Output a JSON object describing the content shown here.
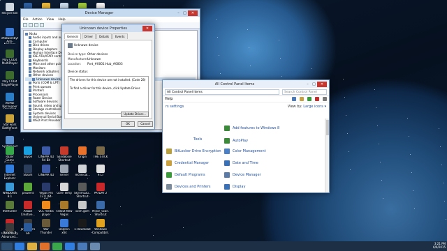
{
  "desktop": {
    "icons": [
      {
        "label": "Recycle Bin",
        "color": "#cfd8e0"
      },
      {
        "label": "",
        "color": "#2d5e9e"
      },
      {
        "label": "",
        "color": "#e7b63a"
      },
      {
        "label": "",
        "color": "#c8d8ea"
      },
      {
        "label": "",
        "color": "#9cc43a"
      },
      {
        "label": "",
        "color": "#f0f0f0"
      },
      {
        "label": "iMalwarebytes Anti-Malware",
        "color": "#3a7ad8"
      },
      {
        "label": "Play COD4 MultiPlayer",
        "color": "#3d6b2e"
      },
      {
        "label": "Play COD4 SinglePlayer",
        "color": "#3d6b2e"
      },
      {
        "label": "AOMEI Backupper Standard",
        "color": "#2a7ec8"
      },
      {
        "label": "Star wars Battlefront II",
        "color": "#c9a23a"
      },
      {
        "label": "System Gif",
        "color": "#5a8fd0"
      },
      {
        "label": "Razer Game Booster",
        "color": "#35a84a"
      },
      {
        "label": "Skype",
        "color": "#1aa0e0"
      },
      {
        "label": "CINEMA 4D R4 Bit",
        "color": "#3c5aa8"
      },
      {
        "label": "SandBoxie Shortcut",
        "color": "#c53a2a"
      },
      {
        "label": "Origin",
        "color": "#e8722c"
      },
      {
        "label": "THE STICK",
        "color": "#7a6a4a"
      },
      {
        "label": "Internet Explorer",
        "color": "#2f7ee0"
      },
      {
        "label": "Steam",
        "color": "#2a3e5c"
      },
      {
        "label": "CINEMA 4D",
        "color": "#3c5aa8"
      },
      {
        "label": "server",
        "color": "#9aa4b0"
      },
      {
        "label": "Technical...",
        "color": "#d0d4d8"
      },
      {
        "label": "9.Cr",
        "color": "#e0e0e0"
      },
      {
        "label": "WINDOWS 8.1",
        "color": "#3a9ad8"
      },
      {
        "label": "pTorrent",
        "color": "#5ca838"
      },
      {
        "label": "Vegas Pro 12.0 (64-bit)",
        "color": "#2a3a6a"
      },
      {
        "label": "Gore Temp",
        "color": "#d8d8d8"
      },
      {
        "label": "SkyrimLau... Shortcut",
        "color": "#5a5a5a"
      },
      {
        "label": "PAYDAY 2",
        "color": "#c8282a"
      },
      {
        "label": "theHunter",
        "color": "#5a7a3a"
      },
      {
        "label": "Adobe Creative...",
        "color": "#c82a2a"
      },
      {
        "label": "VLC media player",
        "color": "#f08a1a"
      },
      {
        "label": "Fallout New Vegas",
        "color": "#a87a2a"
      },
      {
        "label": "ozim.gom",
        "color": "#c8c8c8"
      },
      {
        "label": "Minor_Scan... Shortcut",
        "color": "#3a6aa8"
      },
      {
        "label": "Adobe Reader X",
        "color": "#c8282a"
      },
      {
        "label": "Joystic Pro",
        "color": "#3a3a3a"
      },
      {
        "label": "War Thunder",
        "color": "#6a5a3a"
      },
      {
        "label": "Dolphin x64",
        "color": "#3a7ad8"
      },
      {
        "label": "x-download",
        "color": "#1a1a1a"
      },
      {
        "label": "Windows Compatibili...",
        "color": "#e0a020"
      },
      {
        "label": "Call of Duty Advanced...",
        "color": "#3a3a3a"
      },
      {
        "label": "GIF",
        "color": "#2a5a9a"
      }
    ]
  },
  "device_manager": {
    "title": "Device Manager",
    "menu": [
      "File",
      "Action",
      "View",
      "Help"
    ],
    "tree": [
      {
        "label": "Nicks",
        "indent": 0
      },
      {
        "label": "Audio inputs and outputs",
        "indent": 1
      },
      {
        "label": "Computer",
        "indent": 1
      },
      {
        "label": "Disk drives",
        "indent": 1
      },
      {
        "label": "Display adapters",
        "indent": 1
      },
      {
        "label": "Human Interface Devices",
        "indent": 1
      },
      {
        "label": "IDE ATA/ATAPI controllers",
        "indent": 1
      },
      {
        "label": "Keyboards",
        "indent": 1
      },
      {
        "label": "Mice and other pointing devices",
        "indent": 1
      },
      {
        "label": "Monitors",
        "indent": 1
      },
      {
        "label": "Network adapters",
        "indent": 1
      },
      {
        "label": "Other devices",
        "indent": 1
      },
      {
        "label": "Unknown device",
        "indent": 2,
        "selected": true
      },
      {
        "label": "Ports (COM & LPT)",
        "indent": 1
      },
      {
        "label": "Print queues",
        "indent": 1
      },
      {
        "label": "Printers",
        "indent": 1
      },
      {
        "label": "Processors",
        "indent": 1
      },
      {
        "label": "Razer Device",
        "indent": 1
      },
      {
        "label": "Software devices",
        "indent": 1
      },
      {
        "label": "Sound, video and game controllers",
        "indent": 1
      },
      {
        "label": "Storage controllers",
        "indent": 1
      },
      {
        "label": "System devices",
        "indent": 1
      },
      {
        "label": "Universal Serial Bus controllers",
        "indent": 1
      },
      {
        "label": "WSD Print Provider",
        "indent": 1
      }
    ]
  },
  "properties": {
    "title": "Unknown device Properties",
    "tabs": [
      "General",
      "Driver",
      "Details",
      "Events"
    ],
    "device_name": "Unknown device",
    "fields": [
      {
        "k": "Device type:",
        "v": "Other devices"
      },
      {
        "k": "Manufacturer:",
        "v": "Unknown"
      },
      {
        "k": "Location:",
        "v": "Port_#0001.Hub_#0003"
      }
    ],
    "status_label": "Device status",
    "status_text": [
      "The drivers for this device are not installed. (Code 28)",
      "",
      "To find a driver for this device, click Update Driver."
    ],
    "update_driver": "Update Driver...",
    "ok": "OK",
    "cancel": "Cancel"
  },
  "control_panel": {
    "title": "All Control Panel Items",
    "breadcrumb": "All Control Panel Items",
    "search_placeholder": "Search Control Panel",
    "help": "Help",
    "heading": "rs settings",
    "view_by_label": "View by:",
    "view_by_value": "Large icons ▾",
    "items": [
      {
        "label": "Tools",
        "color": "#7a9ac8"
      },
      {
        "label": "Add features to Windows 8",
        "color": "#3a8a3a"
      },
      {
        "label": "AutoPlay",
        "color": "#3a8a3a"
      },
      {
        "label": "BitLocker Drive Encryption",
        "color": "#b8a040"
      },
      {
        "label": "Color Management",
        "color": "#4a80c8"
      },
      {
        "label": "Credential Manager",
        "color": "#c8a040"
      },
      {
        "label": "Date and Time",
        "color": "#3a70b8"
      },
      {
        "label": "Default Programs",
        "color": "#3a9a3a"
      },
      {
        "label": "Device Manager",
        "color": "#5a7aa8"
      },
      {
        "label": "Devices and Printers",
        "color": "#7a8a9a"
      },
      {
        "label": "Display",
        "color": "#3a70b8"
      }
    ]
  },
  "taskbar": {
    "apps": [
      {
        "name": "ie",
        "color": "#2f7ee0"
      },
      {
        "name": "explorer",
        "color": "#e0b040"
      },
      {
        "name": "vlc",
        "color": "#e0702a"
      },
      {
        "name": "chrome",
        "color": "#3aa84a"
      },
      {
        "name": "ie2",
        "color": "#2f7ee0"
      },
      {
        "name": "control-panel",
        "color": "#4a7ab8"
      },
      {
        "name": "device-manager",
        "color": "#6a8ab0"
      }
    ],
    "time": "3:21 PM",
    "date": "6/6/2015"
  }
}
